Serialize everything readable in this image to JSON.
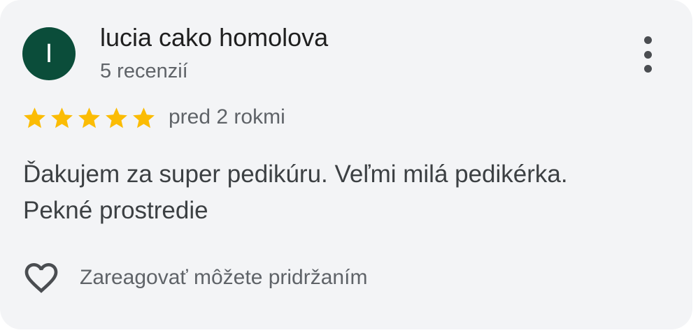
{
  "review": {
    "author_initial": "I",
    "author_name": "lucia cako homolova",
    "author_reviews": "5 recenzií",
    "rating": 5,
    "rating_max": 5,
    "time_ago": "pred 2 rokmi",
    "text_line1": "Ďakujem za super pedikúru. Veľmi milá pedikérka.",
    "text_line2": "Pekné prostredie",
    "react_hint": "Zareagovať môžete pridržaním"
  },
  "icons": {
    "star": "star-icon",
    "more": "more-vert-icon",
    "heart": "heart-outline-icon"
  },
  "colors": {
    "card_background": "#f3f4f6",
    "avatar_background": "#0b4d3a",
    "star": "#fbbc04",
    "secondary_text": "#5f6368"
  }
}
